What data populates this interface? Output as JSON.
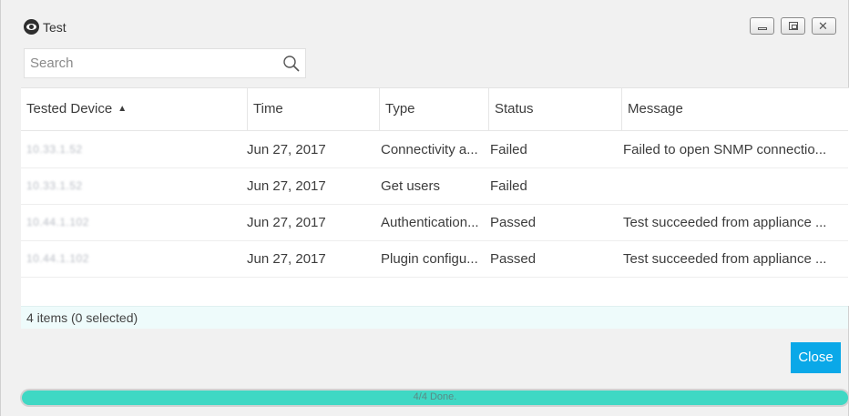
{
  "window": {
    "title": "Test",
    "icon": "eye-icon"
  },
  "search": {
    "placeholder": "Search",
    "value": ""
  },
  "table": {
    "columns": [
      {
        "label": "Tested Device",
        "sorted": "ascending"
      },
      {
        "label": "Time"
      },
      {
        "label": "Type"
      },
      {
        "label": "Status"
      },
      {
        "label": "Message"
      }
    ],
    "rows": [
      {
        "device": "10.33.1.52",
        "time": "Jun 27, 2017",
        "type": "Connectivity a...",
        "status": "Failed",
        "message": "Failed to open SNMP connectio..."
      },
      {
        "device": "10.33.1.52",
        "time": "Jun 27, 2017",
        "type": "Get users",
        "status": "Failed",
        "message": ""
      },
      {
        "device": "10.44.1.102",
        "time": "Jun 27, 2017",
        "type": "Authentication...",
        "status": "Passed",
        "message": "Test succeeded from appliance ..."
      },
      {
        "device": "10.44.1.102",
        "time": "Jun 27, 2017",
        "type": "Plugin configu...",
        "status": "Passed",
        "message": "Test succeeded from appliance ..."
      }
    ]
  },
  "status_bar": {
    "text": "4 items (0 selected)"
  },
  "footer": {
    "close_label": "Close",
    "progress_text": "4/4 Done.",
    "progress_fraction": 1.0
  },
  "colors": {
    "accent": "#0aa8e8",
    "progress": "#3fd8c4"
  }
}
